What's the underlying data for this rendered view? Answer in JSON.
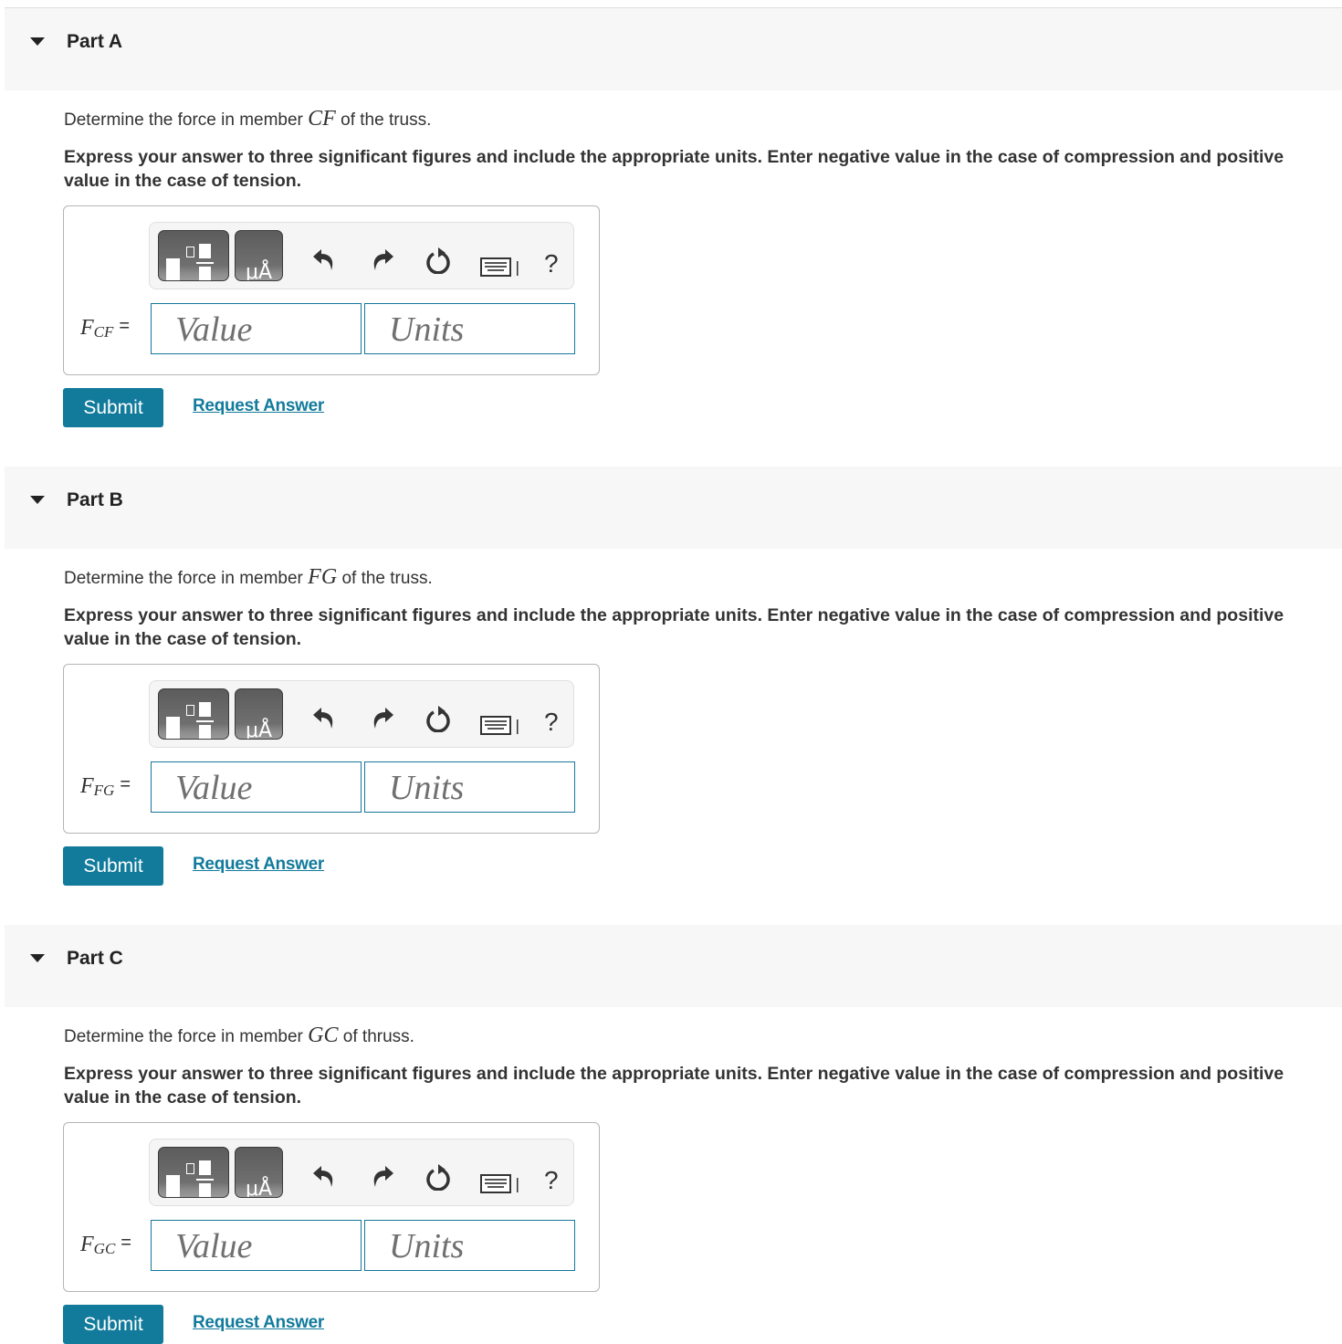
{
  "parts": [
    {
      "title": "Part A",
      "prompt_before": "Determine the force in member ",
      "member": "CF",
      "prompt_after": " of the truss.",
      "instructions": "Express your answer to three significant figures and include the appropriate units. Enter negative value in the case of compression and positive value in the case of tension.",
      "label_var": "F",
      "label_sub": "CF",
      "equals": "=",
      "value_placeholder": "Value",
      "units_placeholder": "Units",
      "submit_label": "Submit",
      "request_label": "Request Answer"
    },
    {
      "title": "Part B",
      "prompt_before": "Determine the force in member ",
      "member": "FG",
      "prompt_after": " of the truss.",
      "instructions": "Express your answer to three significant figures and include the appropriate units. Enter negative value in the case of compression and positive value in the case of tension.",
      "label_var": "F",
      "label_sub": "FG",
      "equals": "=",
      "value_placeholder": "Value",
      "units_placeholder": "Units",
      "submit_label": "Submit",
      "request_label": "Request Answer"
    },
    {
      "title": "Part C",
      "prompt_before": "Determine the force in member ",
      "member": "GC",
      "prompt_after": " of thruss.",
      "instructions": "Express your answer to three significant figures and include the appropriate units. Enter negative value in the case of compression and positive value in the case of tension.",
      "label_var": "F",
      "label_sub": "GC",
      "equals": "=",
      "value_placeholder": "Value",
      "units_placeholder": "Units",
      "submit_label": "Submit",
      "request_label": "Request Answer"
    }
  ],
  "toolbar": {
    "templates_icon": "templates-icon",
    "units_icon": "units-icon",
    "units_glyph": "μÅ",
    "undo_icon": "undo-icon",
    "redo_icon": "redo-icon",
    "reset_icon": "reset-icon",
    "keyboard_icon": "keyboard-icon",
    "help_label": "?"
  },
  "colors": {
    "accent": "#127b9c",
    "header_bg": "#f7f7f7"
  }
}
